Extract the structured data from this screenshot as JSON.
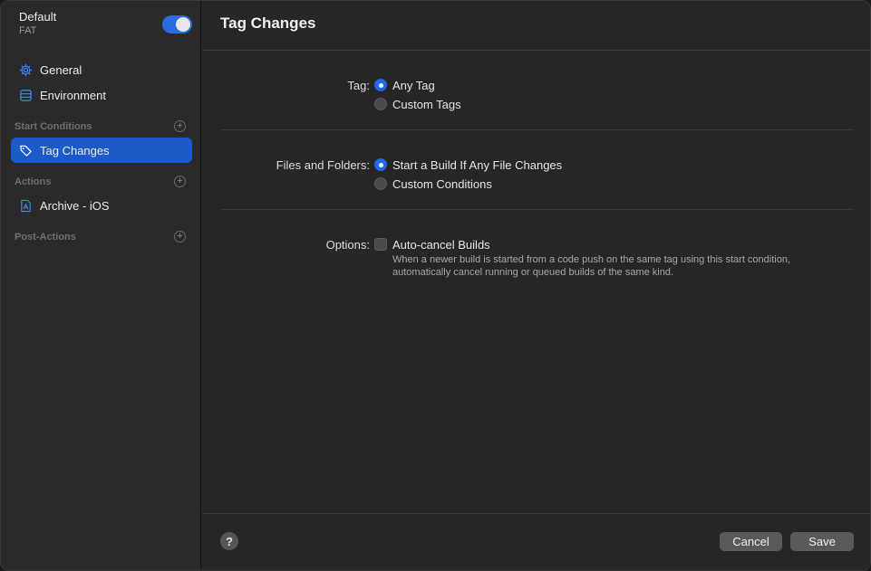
{
  "sidebar": {
    "workflow_name": "Default",
    "workflow_subtitle": "FAT",
    "enabled": true,
    "items": [
      {
        "label": "General",
        "icon": "gear-icon"
      },
      {
        "label": "Environment",
        "icon": "environment-icon"
      }
    ],
    "sections": [
      {
        "label": "Start Conditions",
        "items": [
          {
            "label": "Tag Changes",
            "icon": "tag-icon",
            "selected": true
          }
        ]
      },
      {
        "label": "Actions",
        "items": [
          {
            "label": "Archive - iOS",
            "icon": "archive-icon"
          }
        ]
      },
      {
        "label": "Post-Actions",
        "items": []
      }
    ],
    "plus_glyph": "+"
  },
  "main": {
    "title": "Tag Changes",
    "tag": {
      "label": "Tag:",
      "options": [
        {
          "label": "Any Tag",
          "selected": true
        },
        {
          "label": "Custom Tags",
          "selected": false
        }
      ]
    },
    "files": {
      "label": "Files and Folders:",
      "options": [
        {
          "label": "Start a Build If Any File Changes",
          "selected": true
        },
        {
          "label": "Custom Conditions",
          "selected": false
        }
      ]
    },
    "options": {
      "label": "Options:",
      "checkbox_label": "Auto-cancel Builds",
      "checked": false,
      "description": "When a newer build is started from a code push on the same tag using this start condition, automatically cancel running or queued builds of the same kind."
    }
  },
  "footer": {
    "help_glyph": "?",
    "cancel_label": "Cancel",
    "save_label": "Save"
  },
  "colors": {
    "accent": "#1f68e6",
    "selection": "#1d5ac9",
    "toggle_on": "#2a6ce0"
  }
}
